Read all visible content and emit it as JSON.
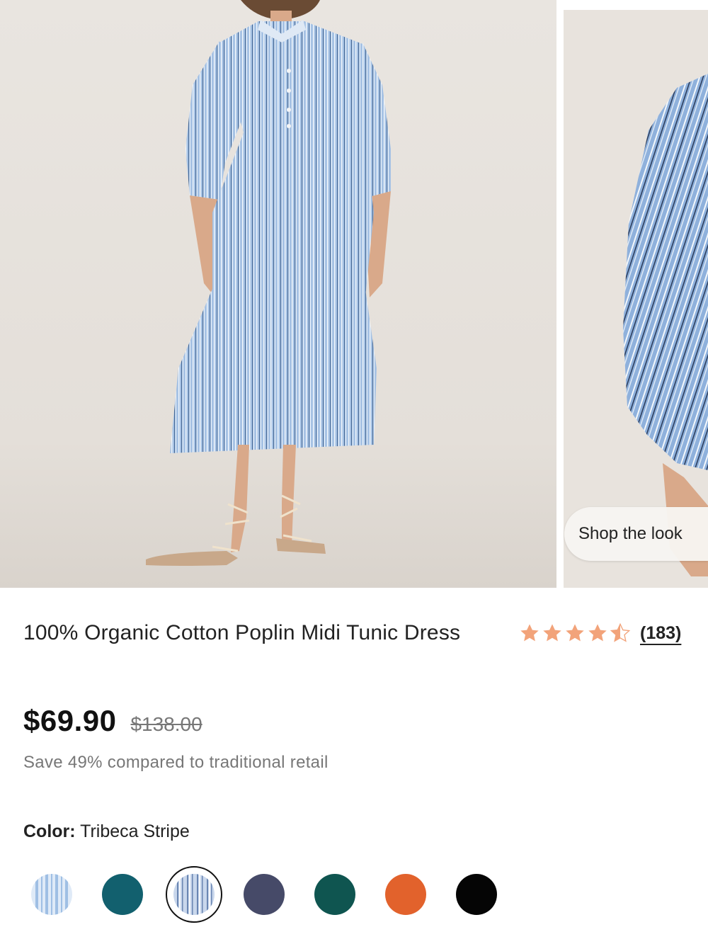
{
  "gallery": {
    "shop_the_look_label": "Shop the look"
  },
  "product": {
    "title": "100% Organic Cotton Poplin Midi Tunic Dress",
    "rating_stars": 4.5,
    "review_count": "(183)",
    "price": "$69.90",
    "original_price": "$138.00",
    "savings_text": "Save 49% compared to traditional retail",
    "color_label": "Color:",
    "color_value": "Tribeca Stripe"
  },
  "colors": {
    "star": "#f2a37a",
    "swatches": [
      "#c7dcf2 striped",
      "#12606e",
      "#b9cbe6 striped",
      "#464a68",
      "#0f5550",
      "#e2622c",
      "#050505"
    ],
    "selected_index": 2
  }
}
